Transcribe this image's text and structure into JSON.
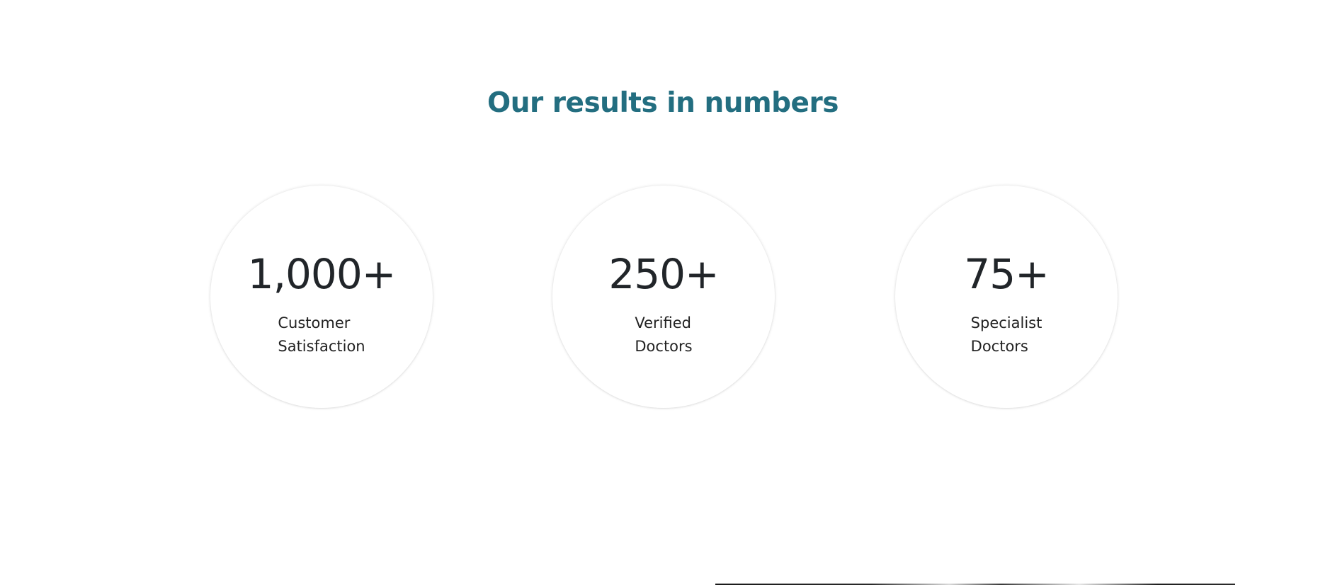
{
  "section": {
    "title": "Our results in numbers"
  },
  "stats": [
    {
      "value": "1,000+",
      "label_line1": "Customer",
      "label_line2": "Satisfaction"
    },
    {
      "value": "250+",
      "label_line1": "Verified",
      "label_line2": "Doctors"
    },
    {
      "value": "75+",
      "label_line1": "Specialist",
      "label_line2": "Doctors"
    }
  ],
  "colors": {
    "title": "#236e80",
    "text": "#222222",
    "background": "#ffffff"
  }
}
